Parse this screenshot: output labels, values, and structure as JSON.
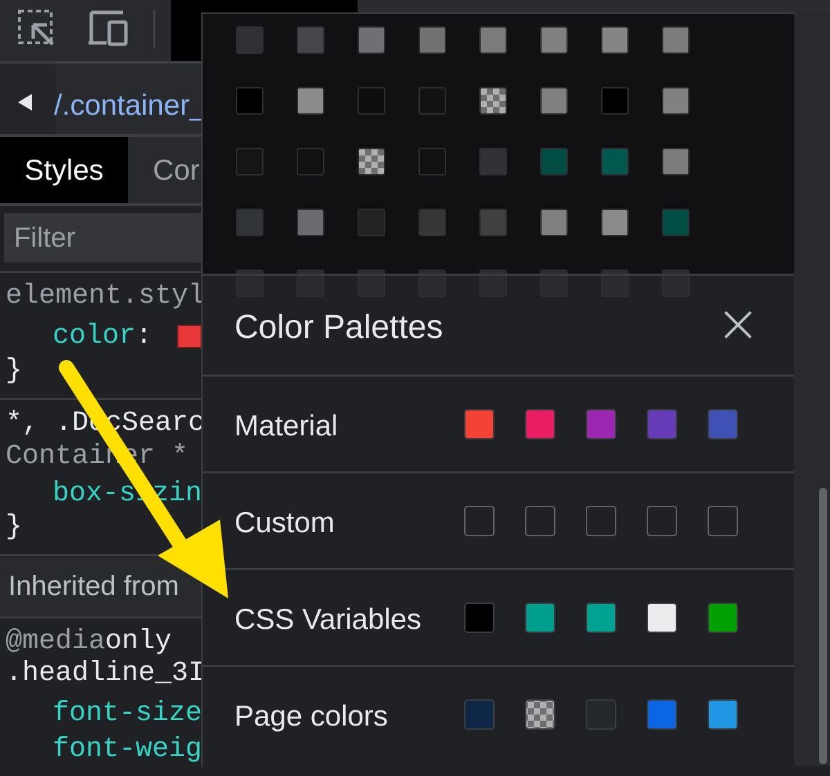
{
  "devtools": {
    "breadcrumb_text": "/.container_",
    "tabs": {
      "styles": "Styles",
      "computed": "Cor"
    },
    "filter_placeholder": "Filter",
    "rules": {
      "element_style_selector": "element.styl",
      "color_property": "color",
      "color_colon": ":",
      "color_swatch": "#e9383a",
      "brace_close": "}",
      "docsearch_selector_1": "*, .DocSearc",
      "docsearch_selector_2": "Container *",
      "box_sizing_property": "box-sizin",
      "inherited_from": "Inherited from",
      "media_query": "@media",
      "media_only": " only",
      "headline_selector": ".headline_3I",
      "font_size_property": "font-size",
      "font_weight_property": "font-weig"
    }
  },
  "popover": {
    "swatch_grid": [
      [
        "#2f3134",
        "#45474b",
        "#6f7073",
        "#717274",
        "#7a7b7d",
        "#7f8082",
        "#848587",
        "#7b7c7e"
      ],
      [
        "#000000",
        "#8a8b8d",
        "#0d0d0e",
        "#121213",
        "#checker",
        "#7e7f81",
        "#000000",
        "#808183"
      ],
      [
        "#151517",
        "#111112",
        "#checker",
        "#111112",
        "#303236",
        "#004d44",
        "#00584f",
        "#7b7c7e"
      ],
      [
        "#313438",
        "#6a6b6e",
        "#222224",
        "#353638",
        "#3f4042",
        "#7e7f81",
        "#8a8b8d",
        "#004d44"
      ]
    ],
    "title": "Color Palettes",
    "palettes": [
      {
        "name": "Material",
        "colors": [
          "#f44336",
          "#e91e63",
          "#9c27b0",
          "#673ab7",
          "#3f51b5"
        ]
      },
      {
        "name": "Custom",
        "colors": [
          "#202124",
          "#202124",
          "#202124",
          "#202124",
          "#202124"
        ]
      },
      {
        "name": "CSS Variables",
        "colors": [
          "#000000",
          "#009e8d",
          "#00a391",
          "#ebecee",
          "#00a000"
        ]
      },
      {
        "name": "Page colors",
        "colors": [
          "#0f2746",
          "#checker",
          "#24272c",
          "#0b66e4",
          "#2196e3"
        ]
      }
    ]
  },
  "annotation": {
    "arrow_color": "#ffe000"
  }
}
